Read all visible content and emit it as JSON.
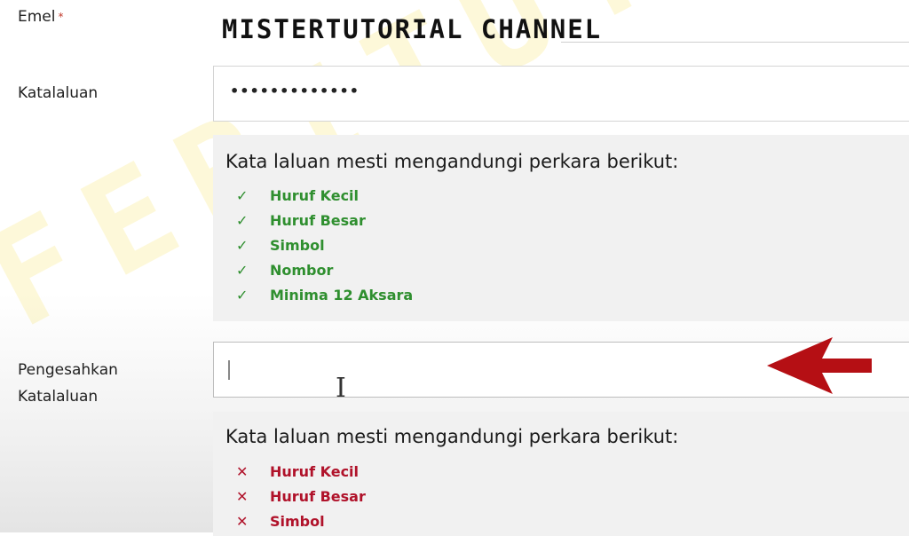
{
  "header": {
    "channel_title": "MISTERTUTORIAL CHANNEL"
  },
  "fields": {
    "email": {
      "label": "Emel",
      "required_mark": "*"
    },
    "password": {
      "label": "Katalaluan",
      "value": "•••••••••••••"
    },
    "confirm": {
      "label_line1": "Pengesahkan",
      "label_line2": "Katalaluan",
      "value": ""
    }
  },
  "password_rules": {
    "title": "Kata laluan mesti mengandungi perkara berikut:",
    "items": [
      {
        "mark": "✓",
        "text": "Huruf Kecil"
      },
      {
        "mark": "✓",
        "text": "Huruf Besar"
      },
      {
        "mark": "✓",
        "text": "Simbol"
      },
      {
        "mark": "✓",
        "text": "Nombor"
      },
      {
        "mark": "✓",
        "text": "Minima 12 Aksara"
      }
    ]
  },
  "confirm_rules": {
    "title": "Kata laluan mesti mengandungi perkara berikut:",
    "items": [
      {
        "mark": "✕",
        "text": "Huruf Kecil"
      },
      {
        "mark": "✕",
        "text": "Huruf Besar"
      },
      {
        "mark": "✕",
        "text": "Simbol"
      }
    ]
  },
  "watermark": "FERITUTORIAL",
  "colors": {
    "ok": "#2f8f2f",
    "bad": "#b0122a",
    "arrow": "#b50f14"
  }
}
